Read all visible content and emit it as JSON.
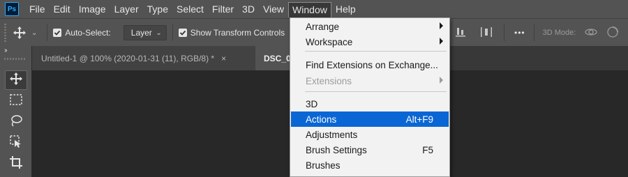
{
  "menubar": {
    "logo": "Ps",
    "items": [
      "File",
      "Edit",
      "Image",
      "Layer",
      "Type",
      "Select",
      "Filter",
      "3D",
      "View",
      "Window",
      "Help"
    ],
    "active": "Window"
  },
  "options": {
    "auto_select_label": "Auto-Select:",
    "auto_select_checked": true,
    "layer_select": "Layer",
    "show_transform_label": "Show Transform Controls",
    "show_transform_checked": true,
    "more_label": "•••",
    "mode_label": "3D Mode:"
  },
  "toolbar": {
    "collapse_label": "››",
    "tools": [
      "move-tool",
      "rectangular-marquee-tool",
      "lasso-tool",
      "object-selection-tool",
      "crop-tool"
    ],
    "selected": "move-tool"
  },
  "tabs": [
    {
      "label": "Untitled-1 @ 100% (2020-01-31 (11), RGB/8) *",
      "close": "×",
      "active": false
    },
    {
      "label": "DSC_0",
      "active": true
    }
  ],
  "window_menu": {
    "items": [
      {
        "label": "Arrange",
        "submenu": true
      },
      {
        "label": "Workspace",
        "submenu": true
      },
      {
        "label": "Find Extensions on Exchange..."
      },
      {
        "label": "Extensions",
        "submenu": true,
        "disabled": true
      },
      {
        "label": "3D"
      },
      {
        "label": "Actions",
        "shortcut": "Alt+F9",
        "highlighted": true
      },
      {
        "label": "Adjustments"
      },
      {
        "label": "Brush Settings",
        "shortcut": "F5"
      },
      {
        "label": "Brushes"
      }
    ]
  },
  "colors": {
    "menubar": "#535353",
    "canvas": "#282828",
    "highlight": "#0a66d4",
    "logo_accent": "#31a8ff"
  }
}
